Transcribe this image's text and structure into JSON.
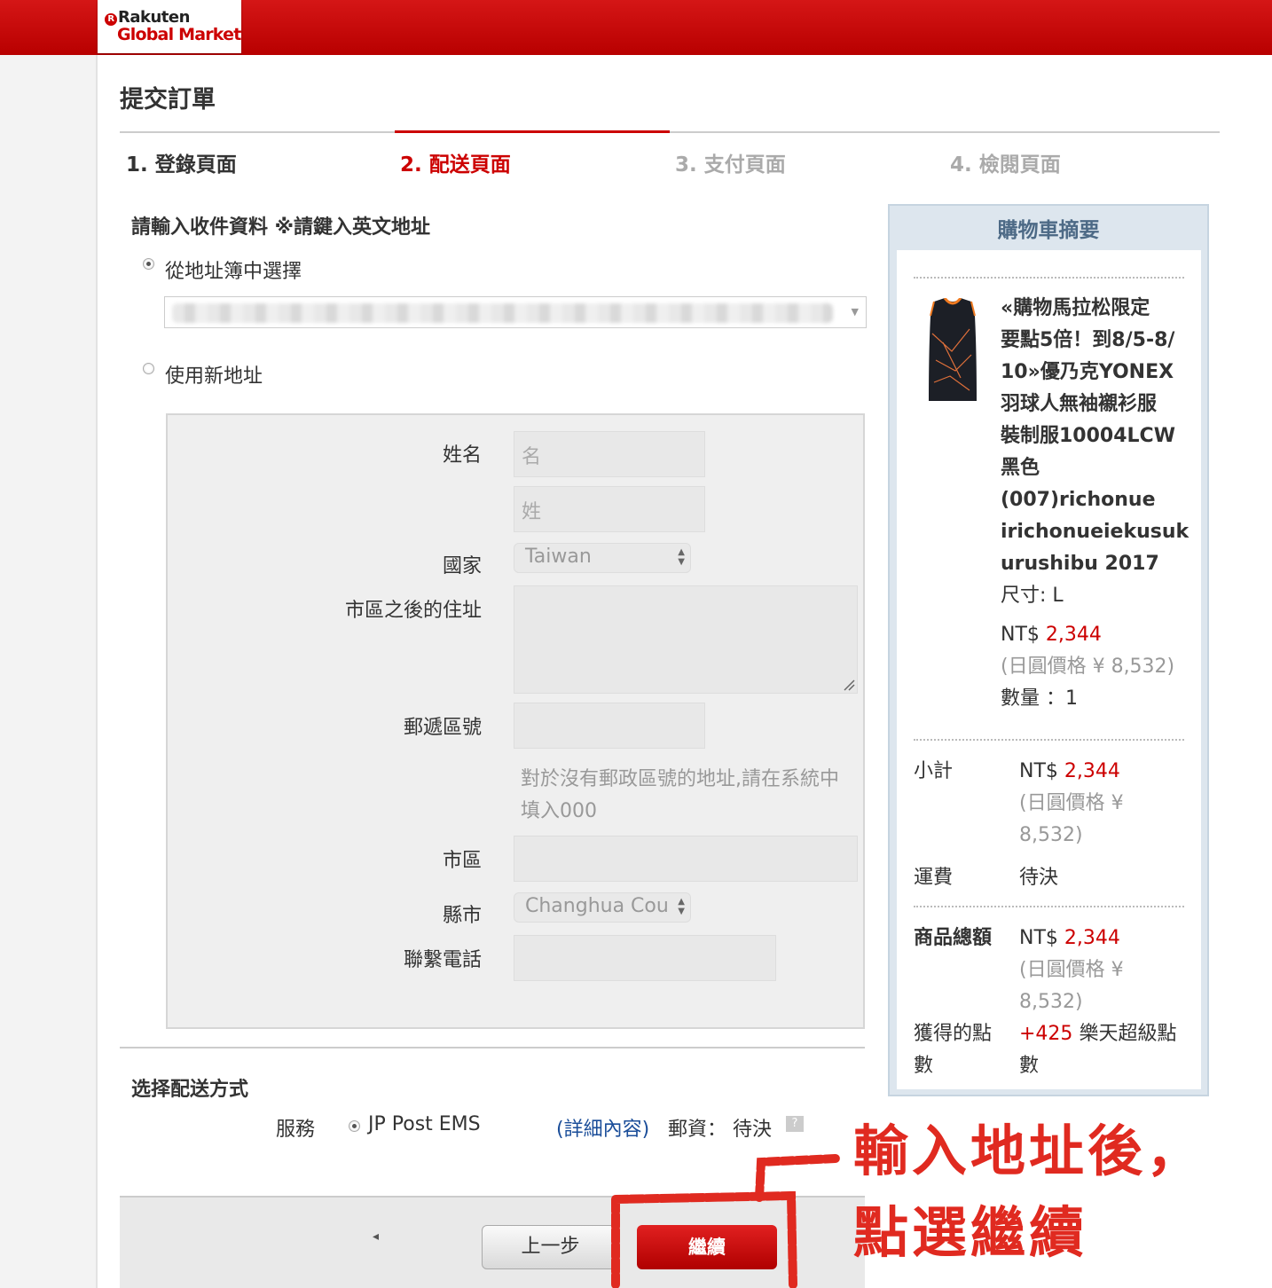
{
  "header": {
    "logo_line1": "Rakuten",
    "logo_line2": "Global Market",
    "logo_r": "R"
  },
  "page": {
    "title": "提交訂單",
    "steps": [
      {
        "label": "1. 登錄頁面",
        "state": "done"
      },
      {
        "label": "2. 配送頁面",
        "state": "active"
      },
      {
        "label": "3. 支付頁面",
        "state": "pending"
      },
      {
        "label": "4. 檢閱頁面",
        "state": "pending"
      }
    ]
  },
  "address": {
    "heading": "請輸入收件資料 ※請鍵入英文地址",
    "option_book": "從地址簿中選擇",
    "book_ellipsis": "..",
    "option_new": "使用新地址",
    "form": {
      "name_label": "姓名",
      "first_name_placeholder": "名",
      "last_name_placeholder": "姓",
      "country_label": "國家",
      "country_value": "Taiwan",
      "street_label": "市區之後的住址",
      "zip_label": "郵遞區號",
      "zip_hint": "對於沒有郵政區號的地址,請在系統中填入000",
      "city_label": "市區",
      "county_label": "縣市",
      "county_value": "Changhua Cou",
      "phone_label": "聯繫電話"
    }
  },
  "shipping": {
    "heading": "选择配送方式",
    "service_label": "服務",
    "service_option": "JP Post EMS",
    "details_link": "(詳細內容)",
    "postage_label": "郵資： 待決",
    "help_glyph": "?"
  },
  "footer": {
    "back_label": "上一步",
    "continue_label": "繼續",
    "small_arrow": "◂"
  },
  "cart": {
    "title": "購物車摘要",
    "product_name": "«購物馬拉松限定要點5倍！到8/5-8/10»優乃克YONEX羽球人無袖襯衫服裝制服10004LCW黑色(007)richonueirichonueiekusukurushibu 2017",
    "product_lines": [
      "«購物馬拉松限定",
      "要點5倍！到8/5-8/",
      "10»優乃克YONEX",
      "羽球人無袖襯衫服",
      "裝制服10004LCW",
      "黑色(007)richonue",
      "irichonueiekusuk",
      "urushibu 2017"
    ],
    "size": "尺寸: L",
    "price_prefix": "NT$",
    "price": "2,344",
    "jpy_price": "(日圓價格 ¥ 8,532)",
    "quantity": "數量 ：1",
    "subtotal_label": "小計",
    "subtotal_prefix": "NT$",
    "subtotal": "2,344",
    "subtotal_jpy_1": "(日圓價格 ¥",
    "subtotal_jpy_2": "8,532)",
    "shipping_label": "運費",
    "shipping_value": "待決",
    "total_label": "商品總額",
    "total_prefix": "NT$",
    "total": "2,344",
    "total_jpy_1": "(日圓價格 ¥",
    "total_jpy_2": "8,532)",
    "points_label_1": "獲得的點",
    "points_label_2": "數",
    "points_value": "+425",
    "points_suffix_1": "樂天超級點",
    "points_suffix_2": "數"
  },
  "annotation": {
    "line1": "輸入地址後，",
    "line2": "點選繼續",
    "color": "#e02a20"
  }
}
